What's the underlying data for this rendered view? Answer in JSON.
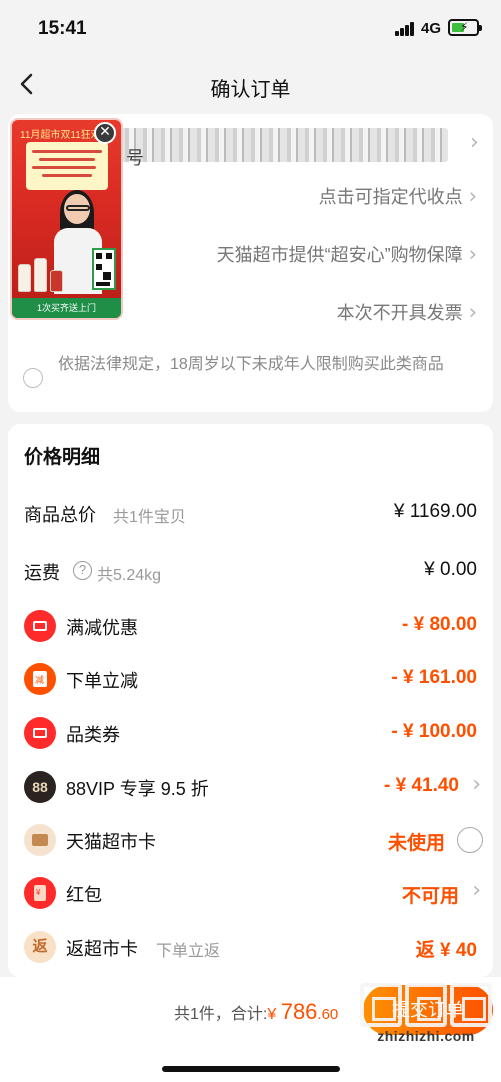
{
  "status_bar": {
    "time": "15:41",
    "network": "4G"
  },
  "nav": {
    "title": "确认订单"
  },
  "address": {
    "partial_text": "号"
  },
  "options": {
    "pickup": "点击可指定代收点",
    "guarantee": "天猫超市提供“超安心”购物保障",
    "invoice": "本次不开具发票"
  },
  "legal": {
    "text": "依据法律规定，18周岁以下未成年人限制购买此类商品"
  },
  "ad": {
    "header": "11月超市双11狂欢",
    "footer": "1次买齐送上门"
  },
  "price_detail": {
    "title": "价格明细",
    "goods_total": {
      "label": "商品总价",
      "sub": "共1件宝贝",
      "value": "¥ 1169.00"
    },
    "shipping": {
      "label": "运费",
      "help": "?",
      "sub": "共5.24kg",
      "value": "¥ 0.00"
    },
    "discounts": [
      {
        "label": "满减优惠",
        "value": "- ¥ 80.00"
      },
      {
        "label": "下单立减",
        "value": "- ¥ 161.00",
        "icon_char": "减"
      },
      {
        "label": "品类券",
        "value": "- ¥ 100.00"
      },
      {
        "label": "88VIP 专享 9.5 折",
        "value": "- ¥ 41.40",
        "icon_char": "88"
      }
    ],
    "supermarket_card": {
      "label": "天猫超市卡",
      "value": "未使用"
    },
    "red_packet": {
      "label": "红包",
      "value": "不可用",
      "icon_char": "¥"
    },
    "rebate_card": {
      "label": "返超市卡",
      "sub": "下单立返",
      "value": "返 ¥ 40",
      "icon_char": "返"
    }
  },
  "footer": {
    "count": "共1件，",
    "total_label": "合计:",
    "currency": "¥ ",
    "total_int": "786",
    "total_dec": ".60",
    "submit": "提交订单"
  },
  "watermark": {
    "site": "zhizhizhi.com"
  },
  "colors": {
    "accent": "#ff5000",
    "background": "#f3f3f3"
  }
}
